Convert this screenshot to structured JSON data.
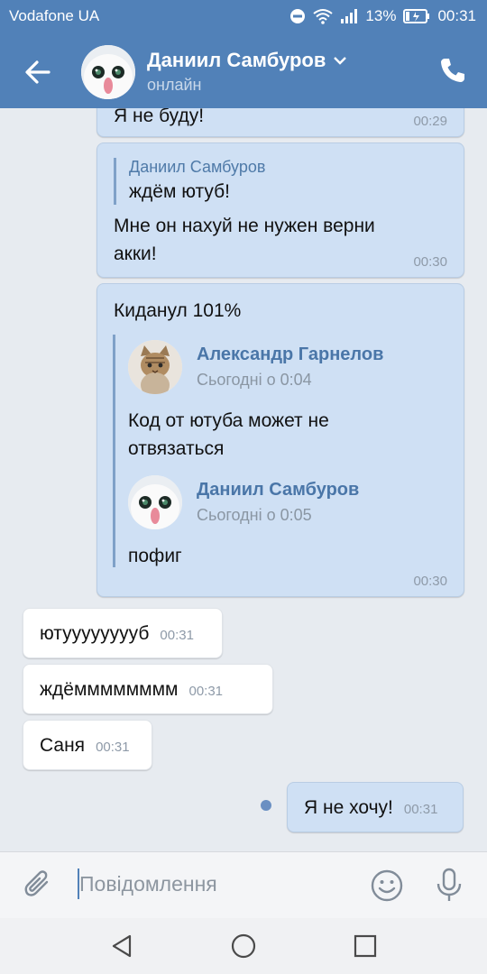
{
  "status_bar": {
    "carrier": "Vodafone UA",
    "battery": "13%",
    "time": "00:31"
  },
  "chat_header": {
    "name": "Даниил Самбуров",
    "status": "онлайн",
    "icons": [
      "back-arrow-icon",
      "chevron-down-icon",
      "phone-icon"
    ]
  },
  "messages": {
    "m1": {
      "text": "Я не буду!",
      "time": "00:29"
    },
    "m2": {
      "quote_name": "Даниил Самбуров",
      "quote_text": "ждём ютуб!",
      "text_line1": "Мне он нахуй не нужен верни",
      "text_line2": "акки!",
      "time": "00:30"
    },
    "m3": {
      "text": "Киданул 101%",
      "fwd1": {
        "author": "Александр Гарнелов",
        "date": "Сьогодні о 0:04",
        "text_line1": "Код от ютуба может не",
        "text_line2": "отвязаться"
      },
      "fwd2": {
        "author": "Даниил Самбуров",
        "date": "Сьогодні о 0:05",
        "text": "пофиг"
      },
      "time": "00:30"
    },
    "m4": {
      "text": "ютууууууууб",
      "time": "00:31"
    },
    "m5": {
      "text": "ждёмммммммм",
      "time": "00:31"
    },
    "m6": {
      "text": "Саня",
      "time": "00:31"
    },
    "m7": {
      "text": "Я не хочу!",
      "time": "00:31"
    }
  },
  "composer": {
    "placeholder": "Повідомлення",
    "icons": [
      "paperclip-icon",
      "emoji-icon",
      "microphone-icon"
    ]
  },
  "colors": {
    "header": "#5181b8",
    "outgoing_bubble": "#cfe0f4",
    "incoming_bubble": "#ffffff",
    "background": "#e7ebf0",
    "link": "#4a76a8"
  }
}
